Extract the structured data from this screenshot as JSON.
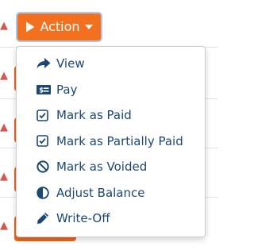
{
  "action_button": {
    "label": "Action",
    "icon": "play-icon",
    "caret_icon": "caret-down-icon",
    "color": "#f3701f"
  },
  "menu": {
    "text_color": "#1a4773",
    "items": [
      {
        "label": "View",
        "icon": "arrow-right-icon"
      },
      {
        "label": "Pay",
        "icon": "money-bill-icon"
      },
      {
        "label": "Mark as Paid",
        "icon": "check-square-icon"
      },
      {
        "label": "Mark as Partially Paid",
        "icon": "check-square-icon"
      },
      {
        "label": "Mark as Voided",
        "icon": "ban-icon"
      },
      {
        "label": "Adjust Balance",
        "icon": "adjust-icon"
      },
      {
        "label": "Write-Off",
        "icon": "pencil-icon"
      }
    ]
  }
}
